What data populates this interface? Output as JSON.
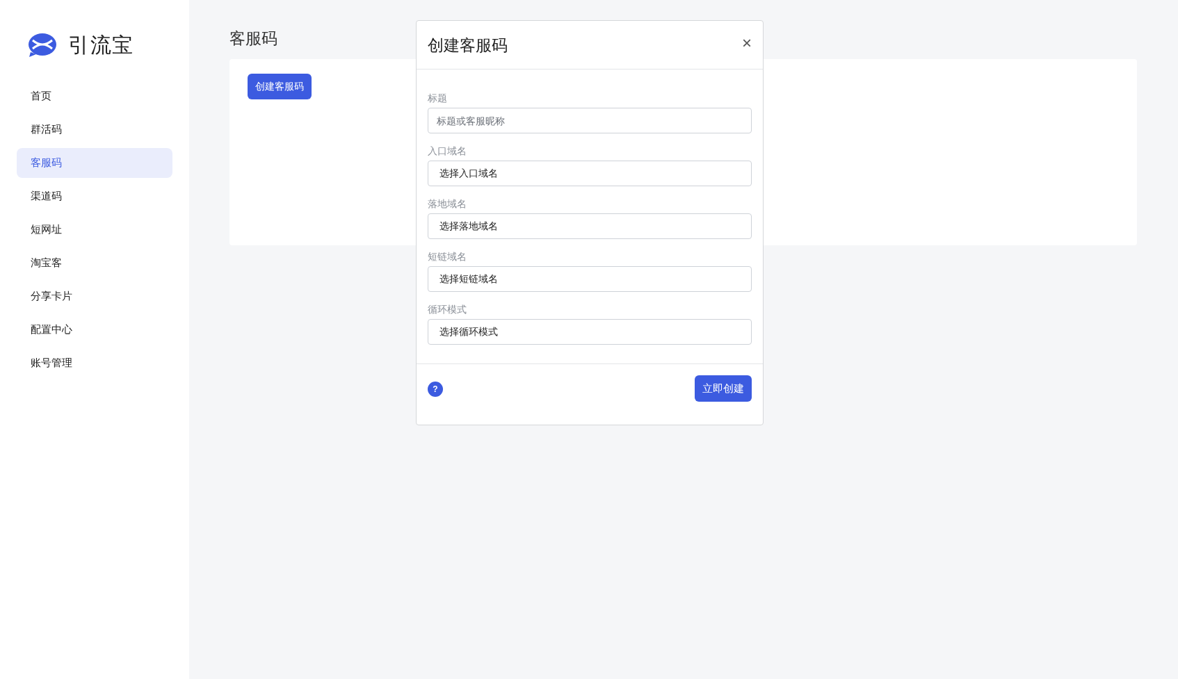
{
  "brand": {
    "name": "引流宝"
  },
  "sidebar": {
    "items": [
      {
        "label": "首页",
        "selected": false
      },
      {
        "label": "群活码",
        "selected": false
      },
      {
        "label": "客服码",
        "selected": true
      },
      {
        "label": "渠道码",
        "selected": false
      },
      {
        "label": "短网址",
        "selected": false
      },
      {
        "label": "淘宝客",
        "selected": false
      },
      {
        "label": "分享卡片",
        "selected": false
      },
      {
        "label": "配置中心",
        "selected": false
      },
      {
        "label": "账号管理",
        "selected": false
      }
    ]
  },
  "page": {
    "title": "客服码",
    "create_button": "创建客服码"
  },
  "dialog": {
    "title": "创建客服码",
    "close": "×",
    "fields": [
      {
        "label": "标题",
        "kind": "text",
        "placeholder": "标题或客服昵称"
      },
      {
        "label": "入口域名",
        "kind": "select",
        "value": "选择入口域名"
      },
      {
        "label": "落地域名",
        "kind": "select",
        "value": "选择落地域名"
      },
      {
        "label": "短链域名",
        "kind": "select",
        "value": "选择短链域名"
      },
      {
        "label": "循环模式",
        "kind": "select",
        "value": "选择循环模式"
      }
    ],
    "help": "?",
    "submit": "立即创建"
  }
}
